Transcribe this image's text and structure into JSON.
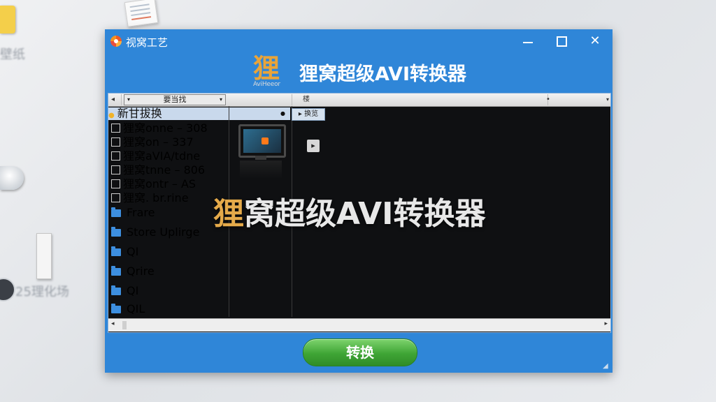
{
  "desktop": {
    "label_1": "壁纸",
    "label_2": "25理化场"
  },
  "window": {
    "title": "视窝工艺",
    "banner_logo_sub": "AviHeeor",
    "banner_title": "狸窝超级AVI转换器"
  },
  "toolbar": {
    "dropdown_value": "要当找",
    "col2": "楼",
    "col3": "•"
  },
  "list": {
    "header": "新甘拔换",
    "items": [
      "狸窝onne – 308",
      "狸窝on  –  337",
      "狸窝aVIA/tdne",
      "狸窝tnne – 806",
      "狸窝ontr – AS",
      "狸窝. br.rine"
    ],
    "folders": [
      "Frare",
      "Store Uplirge",
      "QI",
      "Qrire",
      "QI",
      "QIL"
    ]
  },
  "preview": {
    "tab_label": "▸ 换览"
  },
  "overlay": {
    "title_accent": "狸",
    "title_rest": "窝超级AVI转换器"
  },
  "actions": {
    "convert_label": "转换"
  }
}
